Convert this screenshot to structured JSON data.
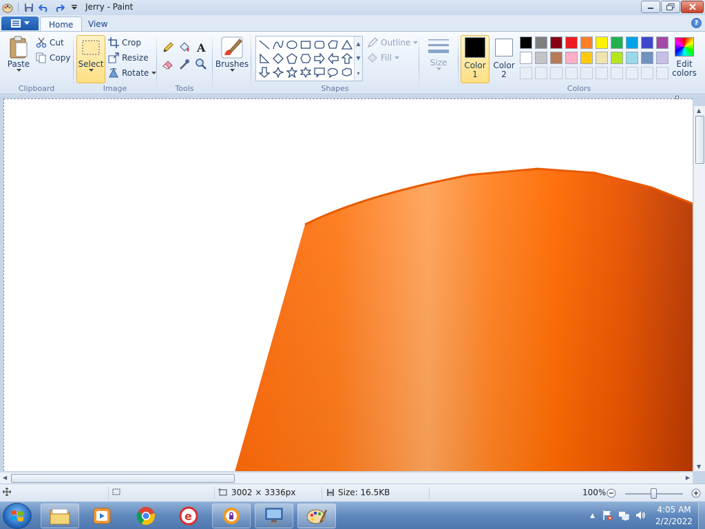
{
  "window": {
    "title": "Jerry - Paint"
  },
  "tabs": {
    "home": "Home",
    "view": "View"
  },
  "clipboard": {
    "paste": "Paste",
    "cut": "Cut",
    "copy": "Copy",
    "label": "Clipboard"
  },
  "image": {
    "select": "Select",
    "crop": "Crop",
    "resize": "Resize",
    "rotate": "Rotate",
    "label": "Image"
  },
  "tools": {
    "label": "Tools"
  },
  "brushes": {
    "label": "Brushes"
  },
  "shapes": {
    "outline": "Outline",
    "fill": "Fill",
    "label": "Shapes"
  },
  "size": {
    "label": "Size"
  },
  "colors": {
    "color1_label": "Color",
    "color1_num": "1",
    "color2_label": "Color",
    "color2_num": "2",
    "edit_label": "Edit",
    "edit_label2": "colors",
    "label": "Colors",
    "color1_value": "#000000",
    "color2_value": "#ffffff",
    "palette": [
      "#000000",
      "#7f7f7f",
      "#880015",
      "#ed1c24",
      "#ff7f27",
      "#fff200",
      "#22b14c",
      "#00a2e8",
      "#3f48cc",
      "#a349a4",
      "#ffffff",
      "#c3c3c3",
      "#b97a57",
      "#ffaec9",
      "#ffc90e",
      "#efe4b0",
      "#b5e61d",
      "#99d9ea",
      "#7092be",
      "#c8bfe7"
    ]
  },
  "status": {
    "dimensions": "3002 × 3336px",
    "size": "Size: 16.5KB",
    "zoom": "100%"
  },
  "taskbar": {
    "time": "4:05 AM",
    "date": "2/2/2022"
  },
  "artwork": {
    "fill_color": "#ff6a10"
  }
}
